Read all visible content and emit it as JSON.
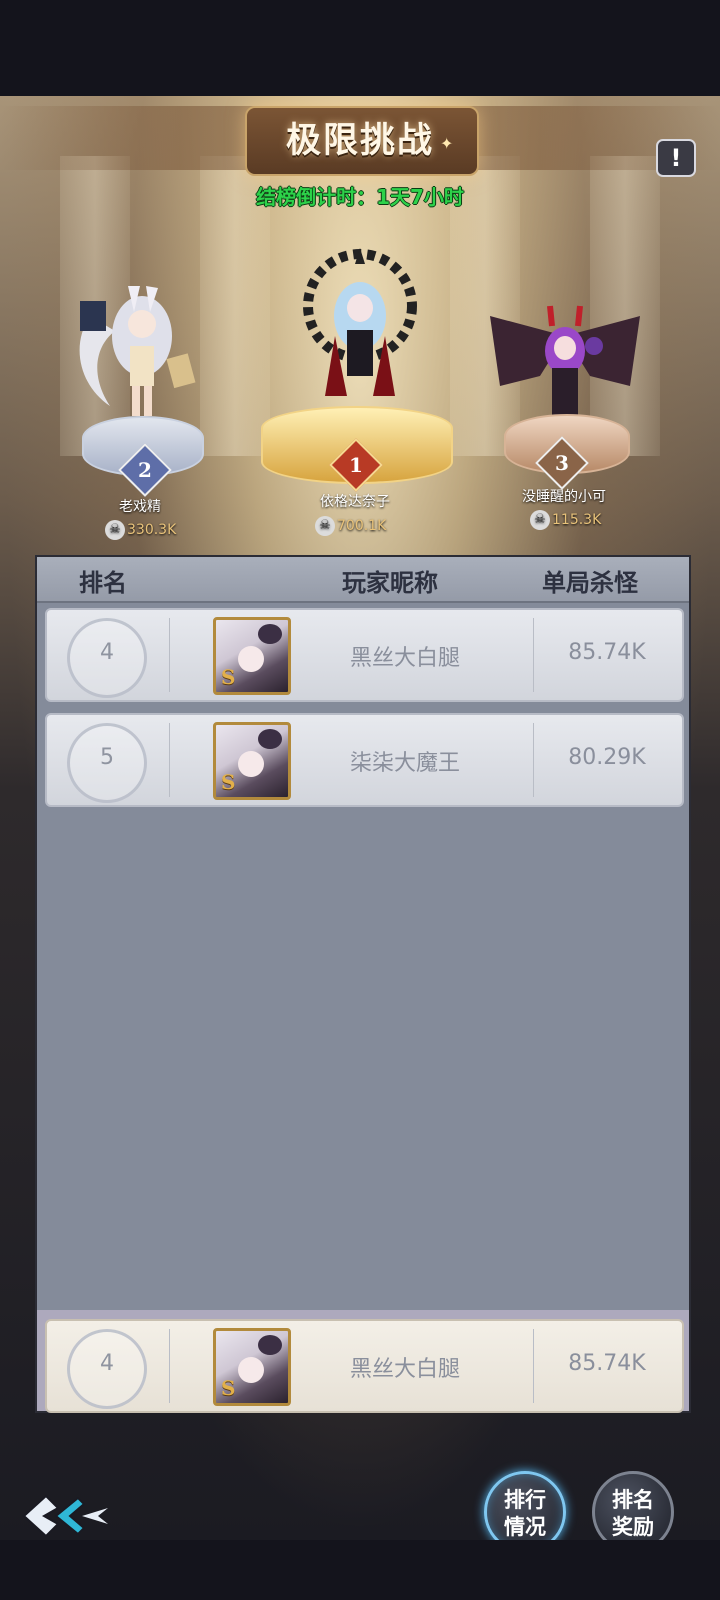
{
  "header": {
    "title": "极限挑战",
    "countdown": "结榜倒计时：1天7小时",
    "help_icon": "exclamation-icon"
  },
  "podium": [
    {
      "rank": "2",
      "name": "老戏精",
      "score": "330.3K",
      "color": "#8ea4d6"
    },
    {
      "rank": "1",
      "name": "依格达奈子",
      "score": "700.1K",
      "color": "#e0b050"
    },
    {
      "rank": "3",
      "name": "没睡醒的小可",
      "score": "115.3K",
      "color": "#c09070"
    }
  ],
  "table": {
    "headers": {
      "rank": "排名",
      "player": "玩家昵称",
      "kills": "单局杀怪"
    },
    "rows": [
      {
        "rank": "4",
        "name": "黑丝大白腿",
        "score": "85.74K",
        "avatar_tag": "S"
      },
      {
        "rank": "5",
        "name": "柒柒大魔王",
        "score": "80.29K",
        "avatar_tag": "S"
      }
    ],
    "self": {
      "rank": "4",
      "name": "黑丝大白腿",
      "score": "85.74K",
      "avatar_tag": "S"
    }
  },
  "buttons": {
    "ranking_status": [
      "排行",
      "情况"
    ],
    "ranking_rewards": [
      "排名",
      "奖励"
    ]
  },
  "colors": {
    "countdown": "#2dd24a",
    "accent_active": "#7fc7f0"
  }
}
